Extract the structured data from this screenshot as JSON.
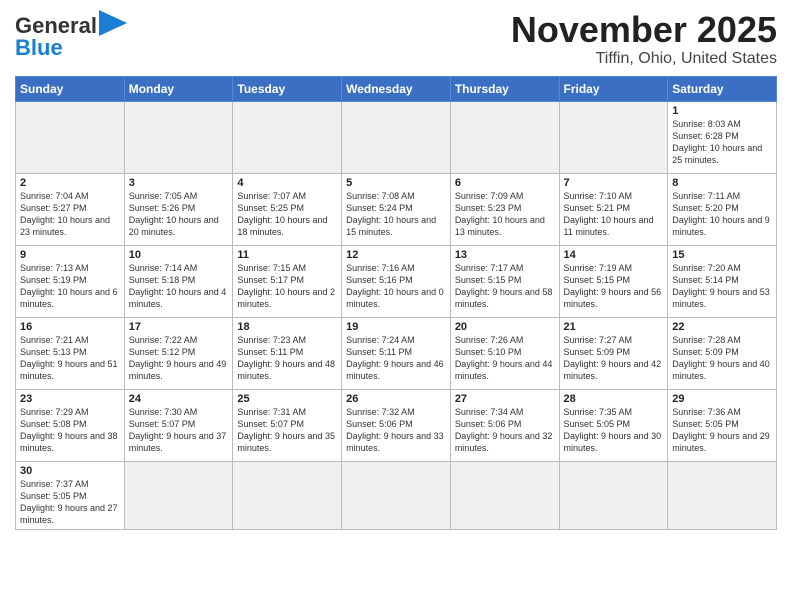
{
  "header": {
    "logo_general": "General",
    "logo_blue": "Blue",
    "title": "November 2025",
    "subtitle": "Tiffin, Ohio, United States"
  },
  "weekdays": [
    "Sunday",
    "Monday",
    "Tuesday",
    "Wednesday",
    "Thursday",
    "Friday",
    "Saturday"
  ],
  "weeks": [
    [
      {
        "day": "",
        "info": ""
      },
      {
        "day": "",
        "info": ""
      },
      {
        "day": "",
        "info": ""
      },
      {
        "day": "",
        "info": ""
      },
      {
        "day": "",
        "info": ""
      },
      {
        "day": "",
        "info": ""
      },
      {
        "day": "1",
        "info": "Sunrise: 8:03 AM\nSunset: 6:28 PM\nDaylight: 10 hours\nand 25 minutes."
      }
    ],
    [
      {
        "day": "2",
        "info": "Sunrise: 7:04 AM\nSunset: 5:27 PM\nDaylight: 10 hours\nand 23 minutes."
      },
      {
        "day": "3",
        "info": "Sunrise: 7:05 AM\nSunset: 5:26 PM\nDaylight: 10 hours\nand 20 minutes."
      },
      {
        "day": "4",
        "info": "Sunrise: 7:07 AM\nSunset: 5:25 PM\nDaylight: 10 hours\nand 18 minutes."
      },
      {
        "day": "5",
        "info": "Sunrise: 7:08 AM\nSunset: 5:24 PM\nDaylight: 10 hours\nand 15 minutes."
      },
      {
        "day": "6",
        "info": "Sunrise: 7:09 AM\nSunset: 5:23 PM\nDaylight: 10 hours\nand 13 minutes."
      },
      {
        "day": "7",
        "info": "Sunrise: 7:10 AM\nSunset: 5:21 PM\nDaylight: 10 hours\nand 11 minutes."
      },
      {
        "day": "8",
        "info": "Sunrise: 7:11 AM\nSunset: 5:20 PM\nDaylight: 10 hours\nand 9 minutes."
      }
    ],
    [
      {
        "day": "9",
        "info": "Sunrise: 7:13 AM\nSunset: 5:19 PM\nDaylight: 10 hours\nand 6 minutes."
      },
      {
        "day": "10",
        "info": "Sunrise: 7:14 AM\nSunset: 5:18 PM\nDaylight: 10 hours\nand 4 minutes."
      },
      {
        "day": "11",
        "info": "Sunrise: 7:15 AM\nSunset: 5:17 PM\nDaylight: 10 hours\nand 2 minutes."
      },
      {
        "day": "12",
        "info": "Sunrise: 7:16 AM\nSunset: 5:16 PM\nDaylight: 10 hours\nand 0 minutes."
      },
      {
        "day": "13",
        "info": "Sunrise: 7:17 AM\nSunset: 5:15 PM\nDaylight: 9 hours\nand 58 minutes."
      },
      {
        "day": "14",
        "info": "Sunrise: 7:19 AM\nSunset: 5:15 PM\nDaylight: 9 hours\nand 56 minutes."
      },
      {
        "day": "15",
        "info": "Sunrise: 7:20 AM\nSunset: 5:14 PM\nDaylight: 9 hours\nand 53 minutes."
      }
    ],
    [
      {
        "day": "16",
        "info": "Sunrise: 7:21 AM\nSunset: 5:13 PM\nDaylight: 9 hours\nand 51 minutes."
      },
      {
        "day": "17",
        "info": "Sunrise: 7:22 AM\nSunset: 5:12 PM\nDaylight: 9 hours\nand 49 minutes."
      },
      {
        "day": "18",
        "info": "Sunrise: 7:23 AM\nSunset: 5:11 PM\nDaylight: 9 hours\nand 48 minutes."
      },
      {
        "day": "19",
        "info": "Sunrise: 7:24 AM\nSunset: 5:11 PM\nDaylight: 9 hours\nand 46 minutes."
      },
      {
        "day": "20",
        "info": "Sunrise: 7:26 AM\nSunset: 5:10 PM\nDaylight: 9 hours\nand 44 minutes."
      },
      {
        "day": "21",
        "info": "Sunrise: 7:27 AM\nSunset: 5:09 PM\nDaylight: 9 hours\nand 42 minutes."
      },
      {
        "day": "22",
        "info": "Sunrise: 7:28 AM\nSunset: 5:09 PM\nDaylight: 9 hours\nand 40 minutes."
      }
    ],
    [
      {
        "day": "23",
        "info": "Sunrise: 7:29 AM\nSunset: 5:08 PM\nDaylight: 9 hours\nand 38 minutes."
      },
      {
        "day": "24",
        "info": "Sunrise: 7:30 AM\nSunset: 5:07 PM\nDaylight: 9 hours\nand 37 minutes."
      },
      {
        "day": "25",
        "info": "Sunrise: 7:31 AM\nSunset: 5:07 PM\nDaylight: 9 hours\nand 35 minutes."
      },
      {
        "day": "26",
        "info": "Sunrise: 7:32 AM\nSunset: 5:06 PM\nDaylight: 9 hours\nand 33 minutes."
      },
      {
        "day": "27",
        "info": "Sunrise: 7:34 AM\nSunset: 5:06 PM\nDaylight: 9 hours\nand 32 minutes."
      },
      {
        "day": "28",
        "info": "Sunrise: 7:35 AM\nSunset: 5:05 PM\nDaylight: 9 hours\nand 30 minutes."
      },
      {
        "day": "29",
        "info": "Sunrise: 7:36 AM\nSunset: 5:05 PM\nDaylight: 9 hours\nand 29 minutes."
      }
    ],
    [
      {
        "day": "30",
        "info": "Sunrise: 7:37 AM\nSunset: 5:05 PM\nDaylight: 9 hours\nand 27 minutes."
      },
      {
        "day": "",
        "info": ""
      },
      {
        "day": "",
        "info": ""
      },
      {
        "day": "",
        "info": ""
      },
      {
        "day": "",
        "info": ""
      },
      {
        "day": "",
        "info": ""
      },
      {
        "day": "",
        "info": ""
      }
    ]
  ]
}
